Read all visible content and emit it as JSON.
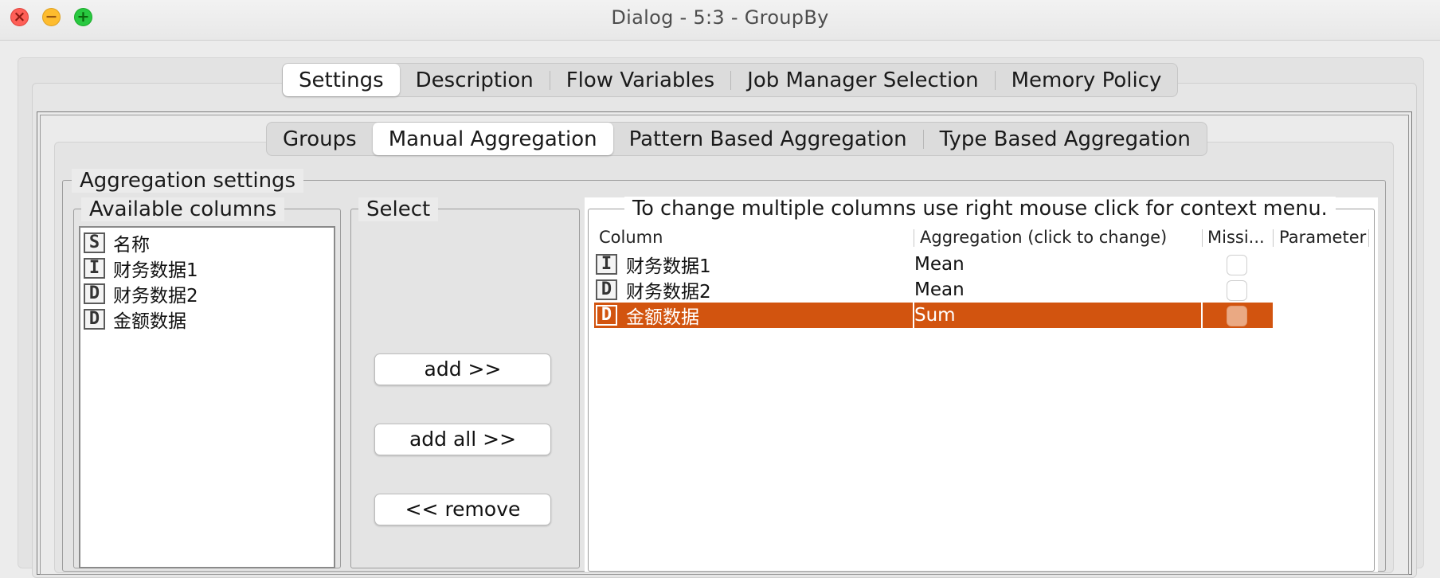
{
  "window": {
    "title": "Dialog - 5:3 - GroupBy",
    "controls": {
      "close_glyph": "×",
      "minimize_glyph": "−",
      "maximize_glyph": "+"
    }
  },
  "outer_tabs": [
    {
      "label": "Settings",
      "active": true
    },
    {
      "label": "Description",
      "active": false
    },
    {
      "label": "Flow Variables",
      "active": false
    },
    {
      "label": "Job Manager Selection",
      "active": false
    },
    {
      "label": "Memory Policy",
      "active": false
    }
  ],
  "inner_tabs": [
    {
      "label": "Groups",
      "active": false
    },
    {
      "label": "Manual Aggregation",
      "active": true
    },
    {
      "label": "Pattern Based Aggregation",
      "active": false
    },
    {
      "label": "Type Based Aggregation",
      "active": false
    }
  ],
  "aggregation": {
    "group_title": "Aggregation settings",
    "available": {
      "title": "Available columns",
      "items": [
        {
          "type": "S",
          "name": "名称"
        },
        {
          "type": "I",
          "name": "财务数据1"
        },
        {
          "type": "D",
          "name": "财务数据2"
        },
        {
          "type": "D",
          "name": "金额数据"
        }
      ]
    },
    "select": {
      "title": "Select",
      "add_label": "add >>",
      "add_all_label": "add all >>",
      "remove_label": "<< remove"
    },
    "table": {
      "hint": "To change multiple columns use right mouse click for context menu.",
      "headers": {
        "column": "Column",
        "aggregation": "Aggregation (click to change)",
        "missing": "Missi...",
        "parameter": "Parameter"
      },
      "rows": [
        {
          "type": "I",
          "column": "财务数据1",
          "aggregation": "Mean",
          "missing": false,
          "selected": false
        },
        {
          "type": "D",
          "column": "财务数据2",
          "aggregation": "Mean",
          "missing": false,
          "selected": false
        },
        {
          "type": "D",
          "column": "金额数据",
          "aggregation": "Sum",
          "missing": false,
          "selected": true
        }
      ]
    }
  },
  "colors": {
    "selection": "#d2540f",
    "close": "#fe5f57",
    "minimize": "#febc2e",
    "maximize": "#28c840"
  }
}
